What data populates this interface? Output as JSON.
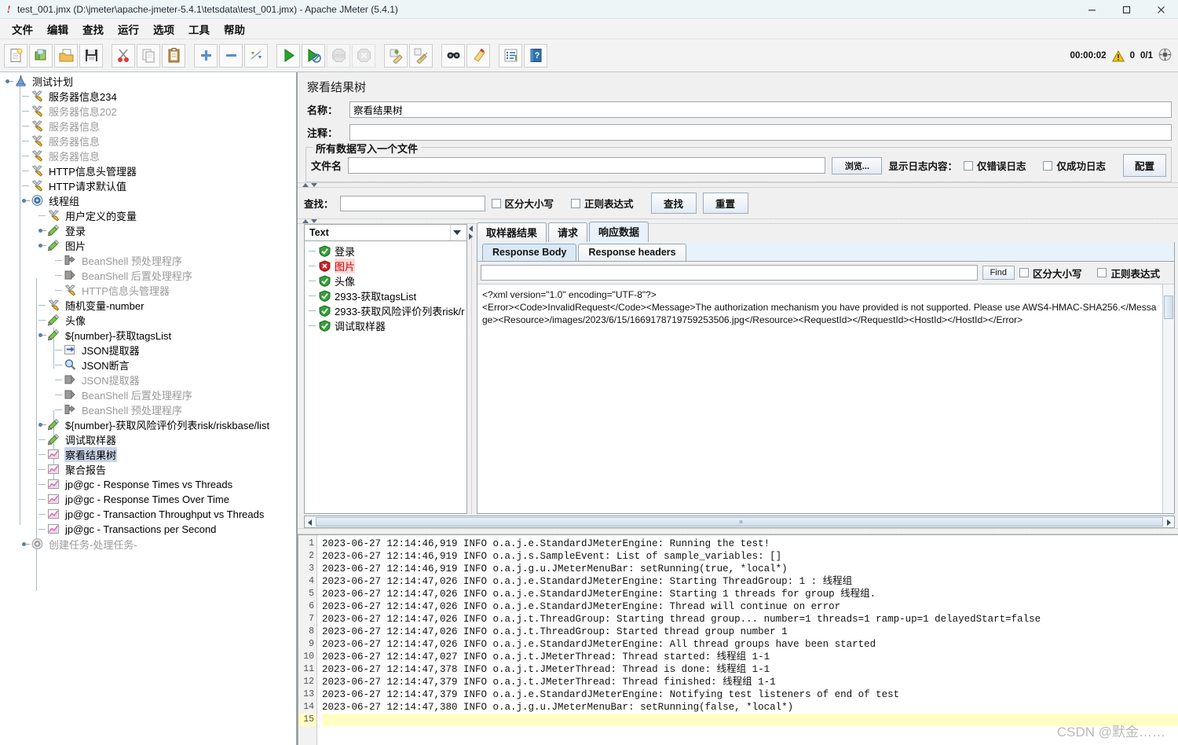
{
  "window": {
    "title": "test_001.jmx (D:\\jmeter\\apache-jmeter-5.4.1\\tetsdata\\test_001.jmx) - Apache JMeter (5.4.1)",
    "minimize": "–",
    "maximize": "☐",
    "close": "×"
  },
  "menu": [
    {
      "label": "文件"
    },
    {
      "label": "编辑"
    },
    {
      "label": "查找"
    },
    {
      "label": "运行"
    },
    {
      "label": "选项"
    },
    {
      "label": "工具"
    },
    {
      "label": "帮助"
    }
  ],
  "toolbar": {
    "buttons": [
      {
        "name": "new-icon",
        "title": "新建"
      },
      {
        "name": "templates-icon",
        "title": "模板"
      },
      {
        "name": "open-icon",
        "title": "打开"
      },
      {
        "name": "save-icon",
        "title": "保存"
      },
      {
        "name": "cut-icon",
        "title": "剪切"
      },
      {
        "name": "copy-icon",
        "title": "复制"
      },
      {
        "name": "paste-icon",
        "title": "粘贴"
      },
      {
        "name": "expand-icon",
        "title": "展开"
      },
      {
        "name": "collapse-icon",
        "title": "收起"
      },
      {
        "name": "toggle-icon",
        "title": "切换"
      },
      {
        "name": "start-icon",
        "title": "启动"
      },
      {
        "name": "start-no-pause-icon",
        "title": "无间隔启动"
      },
      {
        "name": "stop-icon",
        "title": "停止"
      },
      {
        "name": "shutdown-icon",
        "title": "关闭"
      },
      {
        "name": "clear-icon",
        "title": "清除"
      },
      {
        "name": "clear-all-icon",
        "title": "清除全部"
      },
      {
        "name": "search-icon",
        "title": "查找"
      },
      {
        "name": "reset-search-icon",
        "title": "重置查找"
      },
      {
        "name": "function-helper-icon",
        "title": "函数助手"
      },
      {
        "name": "help-icon",
        "title": "帮助"
      }
    ],
    "status": {
      "elapsed": "00:00:02",
      "warnings": "0",
      "threads": "0/1"
    }
  },
  "tree": {
    "nodes": [
      {
        "label": "测试计划",
        "depth": 0,
        "icon": "test-plan-icon",
        "dim": false,
        "selected": false,
        "expander": true
      },
      {
        "label": "服务器信息234",
        "depth": 1,
        "icon": "config-icon",
        "dim": false,
        "selected": false,
        "expander": false
      },
      {
        "label": "服务器信息202",
        "depth": 1,
        "icon": "config-icon",
        "dim": true,
        "selected": false,
        "expander": false
      },
      {
        "label": "服务器信息",
        "depth": 1,
        "icon": "config-icon",
        "dim": true,
        "selected": false,
        "expander": false
      },
      {
        "label": "服务器信息",
        "depth": 1,
        "icon": "config-icon",
        "dim": true,
        "selected": false,
        "expander": false
      },
      {
        "label": "服务器信息",
        "depth": 1,
        "icon": "config-icon",
        "dim": true,
        "selected": false,
        "expander": false
      },
      {
        "label": "HTTP信息头管理器",
        "depth": 1,
        "icon": "config-icon",
        "dim": false,
        "selected": false,
        "expander": false
      },
      {
        "label": "HTTP请求默认值",
        "depth": 1,
        "icon": "config-icon",
        "dim": false,
        "selected": false,
        "expander": false
      },
      {
        "label": "线程组",
        "depth": 1,
        "icon": "thread-group-icon",
        "dim": false,
        "selected": false,
        "expander": true
      },
      {
        "label": "用户定义的变量",
        "depth": 2,
        "icon": "config-icon",
        "dim": false,
        "selected": false,
        "expander": false
      },
      {
        "label": "登录",
        "depth": 2,
        "icon": "sampler-icon",
        "dim": false,
        "selected": false,
        "expander": true
      },
      {
        "label": "图片",
        "depth": 2,
        "icon": "sampler-icon",
        "dim": false,
        "selected": false,
        "expander": true
      },
      {
        "label": "BeanShell 预处理程序",
        "depth": 3,
        "icon": "preprocessor-icon",
        "dim": true,
        "selected": false,
        "expander": false
      },
      {
        "label": "BeanShell 后置处理程序",
        "depth": 3,
        "icon": "postprocessor-icon",
        "dim": true,
        "selected": false,
        "expander": false
      },
      {
        "label": "HTTP信息头管理器",
        "depth": 3,
        "icon": "config-icon",
        "dim": true,
        "selected": false,
        "expander": false
      },
      {
        "label": "随机变量-number",
        "depth": 2,
        "icon": "config-icon",
        "dim": false,
        "selected": false,
        "expander": false
      },
      {
        "label": "头像",
        "depth": 2,
        "icon": "sampler-icon",
        "dim": false,
        "selected": false,
        "expander": false
      },
      {
        "label": "${number}-获取tagsList",
        "depth": 2,
        "icon": "sampler-icon",
        "dim": false,
        "selected": false,
        "expander": true
      },
      {
        "label": "JSON提取器",
        "depth": 3,
        "icon": "postprocessor-icon-blue",
        "dim": false,
        "selected": false,
        "expander": false
      },
      {
        "label": "JSON断言",
        "depth": 3,
        "icon": "assertion-icon",
        "dim": false,
        "selected": false,
        "expander": false
      },
      {
        "label": "JSON提取器",
        "depth": 3,
        "icon": "postprocessor-icon",
        "dim": true,
        "selected": false,
        "expander": false
      },
      {
        "label": "BeanShell 后置处理程序",
        "depth": 3,
        "icon": "postprocessor-icon",
        "dim": true,
        "selected": false,
        "expander": false
      },
      {
        "label": "BeanShell 预处理程序",
        "depth": 3,
        "icon": "preprocessor-icon",
        "dim": true,
        "selected": false,
        "expander": false
      },
      {
        "label": "${number}-获取风险评价列表risk/riskbase/list",
        "depth": 2,
        "icon": "sampler-icon",
        "dim": false,
        "selected": false,
        "expander": true
      },
      {
        "label": "调试取样器",
        "depth": 2,
        "icon": "sampler-icon",
        "dim": false,
        "selected": false,
        "expander": false
      },
      {
        "label": "察看结果树",
        "depth": 2,
        "icon": "listener-icon",
        "dim": false,
        "selected": true,
        "expander": false
      },
      {
        "label": "聚合报告",
        "depth": 2,
        "icon": "listener-icon",
        "dim": false,
        "selected": false,
        "expander": false
      },
      {
        "label": "jp@gc - Response Times vs Threads",
        "depth": 2,
        "icon": "listener-icon",
        "dim": false,
        "selected": false,
        "expander": false
      },
      {
        "label": "jp@gc - Response Times Over Time",
        "depth": 2,
        "icon": "listener-icon",
        "dim": false,
        "selected": false,
        "expander": false
      },
      {
        "label": "jp@gc - Transaction Throughput vs Threads",
        "depth": 2,
        "icon": "listener-icon",
        "dim": false,
        "selected": false,
        "expander": false
      },
      {
        "label": "jp@gc - Transactions per Second",
        "depth": 2,
        "icon": "listener-icon",
        "dim": false,
        "selected": false,
        "expander": false
      },
      {
        "label": "创建任务-处理任务-",
        "depth": 1,
        "icon": "thread-group-gray-icon",
        "dim": true,
        "selected": false,
        "expander": true
      }
    ]
  },
  "panel": {
    "title": "察看结果树",
    "name_label": "名称：",
    "name_value": "察看结果树",
    "comment_label": "注释：",
    "comment_value": "",
    "filegroup_title": "所有数据写入一个文件",
    "filename_label": "文件名",
    "filename_value": "",
    "browse_button": "浏览...",
    "log_display_label": "显示日志内容：",
    "errors_only_label": "仅错误日志",
    "success_only_label": "仅成功日志",
    "configure_button": "配置"
  },
  "search": {
    "label": "查找：",
    "value": "",
    "match_case_label": "区分大小写",
    "regex_label": "正则表达式",
    "find_button": "查找",
    "reset_button": "重置"
  },
  "results": {
    "format_selected": "Text",
    "items": [
      {
        "label": "登录",
        "status": "ok"
      },
      {
        "label": "图片",
        "status": "error"
      },
      {
        "label": "头像",
        "status": "ok"
      },
      {
        "label": "2933-获取tagsList",
        "status": "ok"
      },
      {
        "label": "2933-获取风险评价列表risk/r",
        "status": "ok"
      },
      {
        "label": "调试取样器",
        "status": "ok"
      }
    ]
  },
  "response": {
    "tabs": [
      {
        "label": "取样器结果",
        "active": false
      },
      {
        "label": "请求",
        "active": false
      },
      {
        "label": "响应数据",
        "active": true
      }
    ],
    "subtabs": [
      {
        "label": "Response Body",
        "active": true
      },
      {
        "label": "Response headers",
        "active": false
      }
    ],
    "find_value": "",
    "find_button": "Find",
    "match_case_label": "区分大小写",
    "regex_label": "正则表达式",
    "body_lines": [
      "<?xml version=\"1.0\" encoding=\"UTF-8\"?>",
      "<Error><Code>InvalidRequest</Code><Message>The authorization mechanism you have provided is not supported. Please use AWS4-HMAC-SHA256.</Message><Resource>/images/2023/6/15/1669178719759253506.jpg</Resource><RequestId></RequestId><HostId></HostId></Error>"
    ]
  },
  "log": {
    "lines": [
      {
        "n": "1",
        "text": "2023-06-27 12:14:46,919 INFO o.a.j.e.StandardJMeterEngine: Running the test!"
      },
      {
        "n": "2",
        "text": "2023-06-27 12:14:46,919 INFO o.a.j.s.SampleEvent: List of sample_variables: []"
      },
      {
        "n": "3",
        "text": "2023-06-27 12:14:46,919 INFO o.a.j.g.u.JMeterMenuBar: setRunning(true, *local*)"
      },
      {
        "n": "4",
        "text": "2023-06-27 12:14:47,026 INFO o.a.j.e.StandardJMeterEngine: Starting ThreadGroup: 1 : 线程组"
      },
      {
        "n": "5",
        "text": "2023-06-27 12:14:47,026 INFO o.a.j.e.StandardJMeterEngine: Starting 1 threads for group 线程组."
      },
      {
        "n": "6",
        "text": "2023-06-27 12:14:47,026 INFO o.a.j.e.StandardJMeterEngine: Thread will continue on error"
      },
      {
        "n": "7",
        "text": "2023-06-27 12:14:47,026 INFO o.a.j.t.ThreadGroup: Starting thread group... number=1 threads=1 ramp-up=1 delayedStart=false"
      },
      {
        "n": "8",
        "text": "2023-06-27 12:14:47,026 INFO o.a.j.t.ThreadGroup: Started thread group number 1"
      },
      {
        "n": "9",
        "text": "2023-06-27 12:14:47,026 INFO o.a.j.e.StandardJMeterEngine: All thread groups have been started"
      },
      {
        "n": "10",
        "text": "2023-06-27 12:14:47,027 INFO o.a.j.t.JMeterThread: Thread started: 线程组 1-1"
      },
      {
        "n": "11",
        "text": "2023-06-27 12:14:47,378 INFO o.a.j.t.JMeterThread: Thread is done: 线程组 1-1"
      },
      {
        "n": "12",
        "text": "2023-06-27 12:14:47,379 INFO o.a.j.t.JMeterThread: Thread finished: 线程组 1-1"
      },
      {
        "n": "13",
        "text": "2023-06-27 12:14:47,379 INFO o.a.j.e.StandardJMeterEngine: Notifying test listeners of end of test"
      },
      {
        "n": "14",
        "text": "2023-06-27 12:14:47,380 INFO o.a.j.g.u.JMeterMenuBar: setRunning(false, *local*)"
      },
      {
        "n": "15",
        "text": "",
        "highlight": true
      }
    ]
  },
  "watermark": "CSDN @默金……",
  "colors": {
    "accent": "#2b6cb0",
    "error": "#cc0000",
    "ok": "#3a9b35",
    "selection": "#c9d3e8",
    "highlight": "#ffffc4"
  }
}
